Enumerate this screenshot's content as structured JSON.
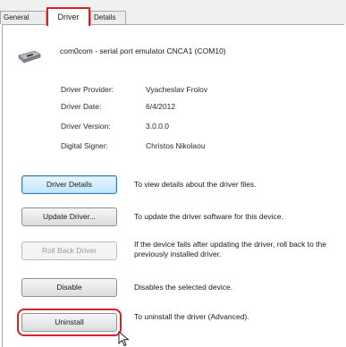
{
  "tabs": [
    {
      "label": "General"
    },
    {
      "label": "Driver"
    },
    {
      "label": "Details"
    }
  ],
  "device": {
    "icon": "serial-port-device-icon",
    "name": "com0com - serial port emulator CNCA1 (COM10)"
  },
  "info": [
    {
      "label": "Driver Provider:",
      "value": "Vyacheslav Frolov"
    },
    {
      "label": "Driver Date:",
      "value": "6/4/2012"
    },
    {
      "label": "Driver Version:",
      "value": "3.0.0.0"
    },
    {
      "label": "Digital Signer:",
      "value": "Christos Nikolaou"
    }
  ],
  "buttons": [
    {
      "label": "Driver Details",
      "description": "To view details about the driver files."
    },
    {
      "label": "Update Driver...",
      "description": "To update the driver software for this device."
    },
    {
      "label": "Roll Back Driver",
      "description": "If the device fails after updating the driver, roll back to the previously installed driver."
    },
    {
      "label": "Disable",
      "description": "Disables the selected device."
    },
    {
      "label": "Uninstall",
      "description": "To uninstall the driver (Advanced)."
    }
  ],
  "colors": {
    "highlight": "#d9202a",
    "focus_border": "#3c7fb1"
  }
}
